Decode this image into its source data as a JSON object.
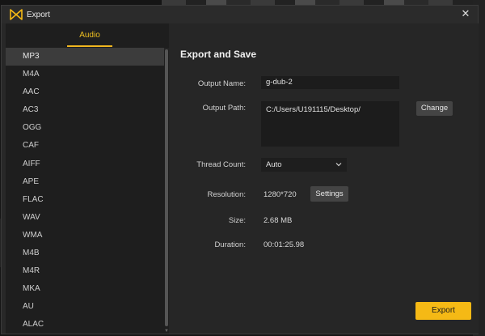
{
  "window": {
    "title": "Export"
  },
  "left_panel": {
    "tab": "Audio",
    "formats": [
      "MP3",
      "M4A",
      "AAC",
      "AC3",
      "OGG",
      "CAF",
      "AIFF",
      "APE",
      "FLAC",
      "WAV",
      "WMA",
      "M4B",
      "M4R",
      "MKA",
      "AU",
      "ALAC"
    ],
    "selected_format": "MP3"
  },
  "main": {
    "heading": "Export and Save",
    "output_name_label": "Output Name:",
    "output_name_value": "g-dub-2",
    "output_path_label": "Output Path:",
    "output_path_value": "C:/Users/U191115/Desktop/",
    "change_button": "Change",
    "thread_count_label": "Thread Count:",
    "thread_count_value": "Auto",
    "resolution_label": "Resolution:",
    "resolution_value": "1280*720",
    "settings_button": "Settings",
    "size_label": "Size:",
    "size_value": "2.68 MB",
    "duration_label": "Duration:",
    "duration_value": "00:01:25.98",
    "export_button": "Export"
  },
  "colors": {
    "accent": "#f5b915",
    "background": "#262626",
    "list_background": "#1e1e1e"
  },
  "icons": {
    "logo": "app-logo-icon",
    "close": "close-icon",
    "dropdown": "chevron-down-icon"
  }
}
